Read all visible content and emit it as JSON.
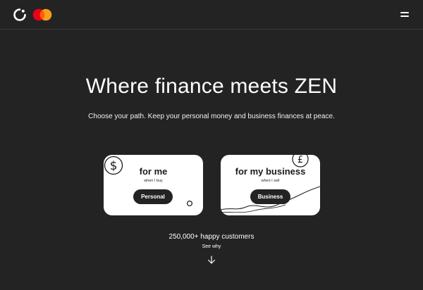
{
  "header": {
    "logo_icon": "zen-logo-icon",
    "partner_icon": "mastercard-logo-icon",
    "menu_icon": "hamburger-menu-icon"
  },
  "hero": {
    "title": "Where finance meets ZEN",
    "subtitle": "Choose your path. Keep your personal money and business finances at peace."
  },
  "cards": [
    {
      "title": "for me",
      "caption": "when I buy",
      "button_label": "Personal",
      "icon": "dollar-coin-icon"
    },
    {
      "title": "for my business",
      "caption": "when I sell",
      "button_label": "Business",
      "icon": "pound-coin-icon"
    }
  ],
  "footer": {
    "customers_text": "250,000+ happy customers",
    "see_why_label": "See why",
    "arrow_icon": "arrow-down-icon"
  },
  "colors": {
    "background": "#242324",
    "card": "#ffffff",
    "button": "#242324",
    "mastercard_red": "#eb001b",
    "mastercard_orange": "#f79e1b"
  }
}
